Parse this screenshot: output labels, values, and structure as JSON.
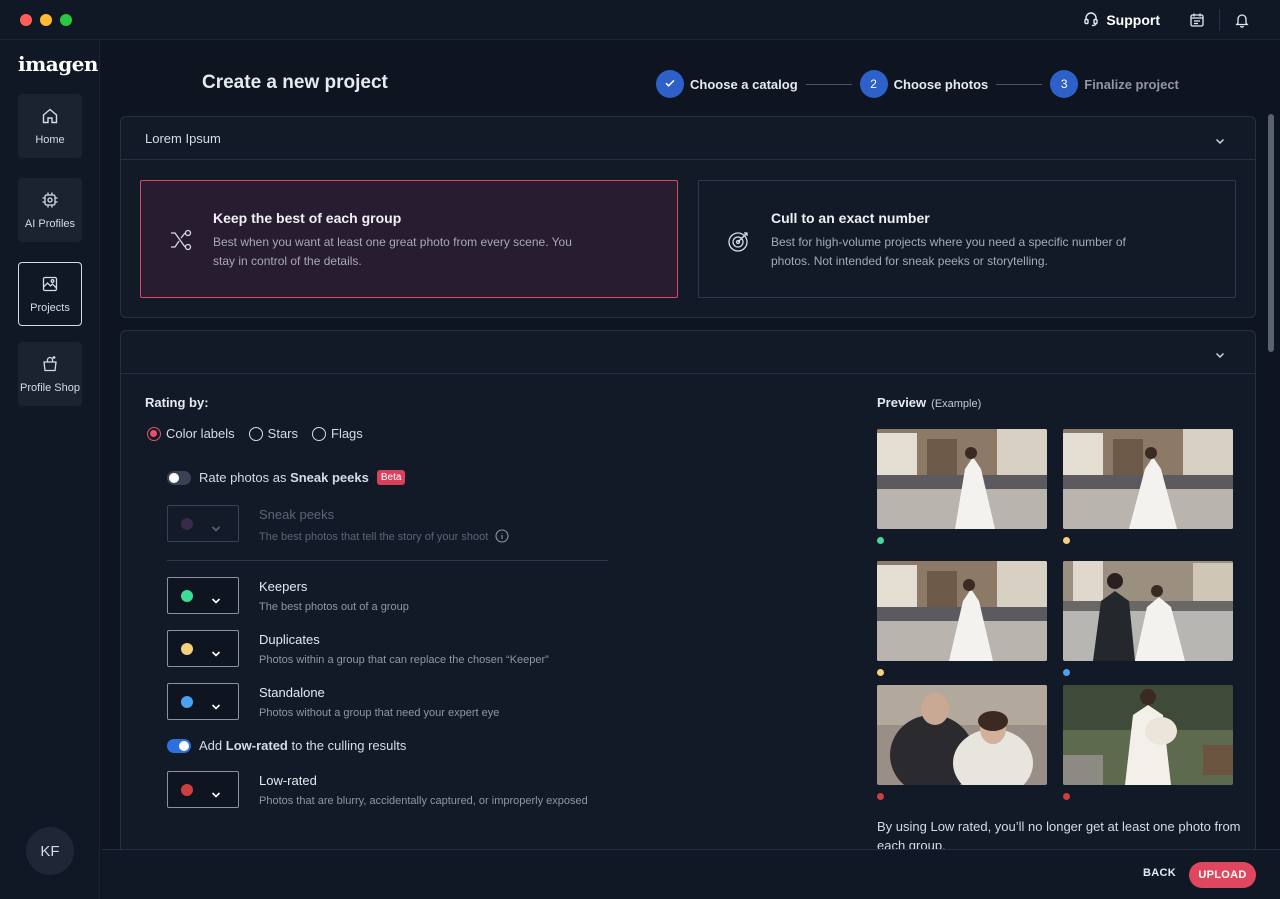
{
  "titlebar": {
    "support_label": "Support"
  },
  "sidebar": {
    "logo": "imagen",
    "items": [
      {
        "label": "Home",
        "icon": "home-icon"
      },
      {
        "label": "AI Profiles",
        "icon": "ai-chip-icon"
      },
      {
        "label": "Projects",
        "icon": "projects-icon"
      },
      {
        "label": "Profile Shop",
        "icon": "shop-bag-icon"
      }
    ],
    "avatar_initials": "KF"
  },
  "header": {
    "title": "Create a new project"
  },
  "stepper": {
    "steps": [
      {
        "number": "",
        "label": "Choose a catalog",
        "state": "done"
      },
      {
        "number": "2",
        "label": "Choose photos",
        "state": "active"
      },
      {
        "number": "3",
        "label": "Finalize project",
        "state": "upcoming"
      }
    ]
  },
  "panel1": {
    "header_label": "Lorem Ipsum",
    "options": [
      {
        "title": "Keep the best of each group",
        "description": "Best when you want at least one great photo from every scene. You stay in control of the details.",
        "selected": true
      },
      {
        "title": "Cull to an exact number",
        "description": "Best for high-volume projects where you need a specific number of photos. Not intended for sneak peeks or storytelling.",
        "selected": false
      }
    ]
  },
  "panel2": {
    "rating_by_label": "Rating by:",
    "rating_options": [
      "Color labels",
      "Stars",
      "Flags"
    ],
    "rating_selected": "Color labels",
    "sneak_toggle": {
      "prefix": "Rate photos as ",
      "bold": "Sneak peeks",
      "badge": "Beta",
      "on": false
    },
    "sneak_row": {
      "title": "Sneak peeks",
      "description": "The best photos that tell the story of your shoot",
      "color": "#3a2a4a"
    },
    "label_rows": [
      {
        "title": "Keepers",
        "description": "The best photos out of a group",
        "color": "#3ddc97"
      },
      {
        "title": "Duplicates",
        "description": "Photos within a group that can replace the chosen “Keeper”",
        "color": "#f2d27a"
      },
      {
        "title": "Standalone",
        "description": "Photos without a group that need your expert eye",
        "color": "#4aa3f0"
      }
    ],
    "lowrated_toggle": {
      "prefix": "Add ",
      "bold": "Low-rated",
      "suffix": " to the culling results",
      "on": true
    },
    "lowrated_row": {
      "title": "Low-rated",
      "description": "Photos that are blurry, accidentally captured, or improperly exposed",
      "color": "#c9403f"
    },
    "preview": {
      "title": "Preview",
      "subtitle": "(Example)",
      "photo_dots": [
        "#3ddc97",
        "#f2d27a",
        "#f2d27a",
        "#4aa3f0",
        "#c9403f",
        "#c9403f"
      ],
      "note": "By using Low rated, you’ll no longer get at least one photo from each group."
    }
  },
  "footer": {
    "back_label": "BACK",
    "upload_label": "UPLOAD"
  },
  "colors": {
    "accent": "#e0475f",
    "step_blue": "#2e60c9",
    "toggle_blue": "#2e6fe0"
  }
}
